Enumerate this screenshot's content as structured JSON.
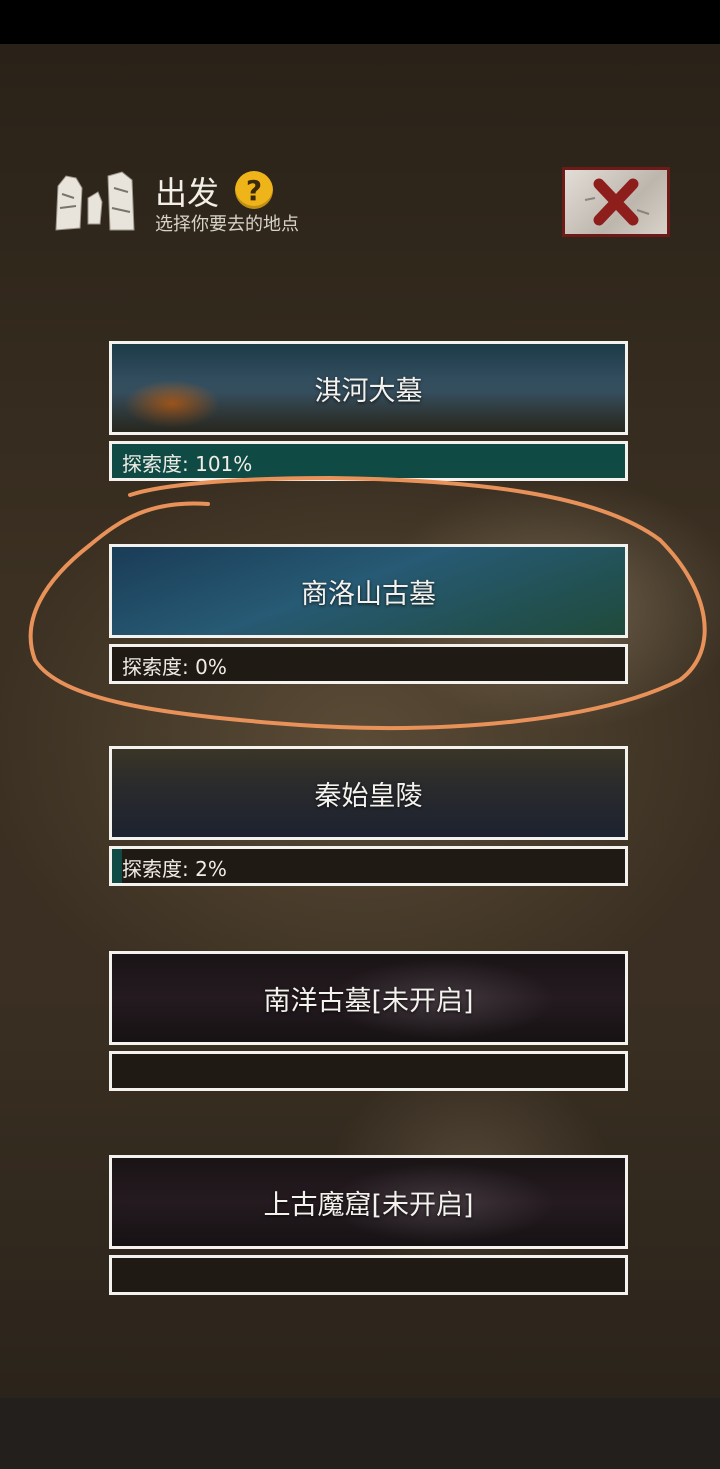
{
  "header": {
    "title": "出发",
    "help_symbol": "?",
    "subtitle": "选择你要去的地点",
    "icon": "stone-figures-icon",
    "close_icon": "close-x-icon"
  },
  "locations": [
    {
      "name": "淇河大墓",
      "progress_label": "探索度: 101%",
      "progress_percent": 101
    },
    {
      "name": "商洛山古墓",
      "progress_label": "探索度: 0%",
      "progress_percent": 0
    },
    {
      "name": "秦始皇陵",
      "progress_label": "探索度: 2%",
      "progress_percent": 2
    },
    {
      "name": "南洋古墓[未开启]",
      "progress_label": "",
      "progress_percent": 0
    },
    {
      "name": "上古魔窟[未开启]",
      "progress_label": "",
      "progress_percent": 0
    }
  ],
  "colors": {
    "progress_fill": "#0f4a44",
    "highlight_stroke": "#e8925a",
    "close_border": "#6e1a18",
    "help_badge": "#f0b41b"
  }
}
